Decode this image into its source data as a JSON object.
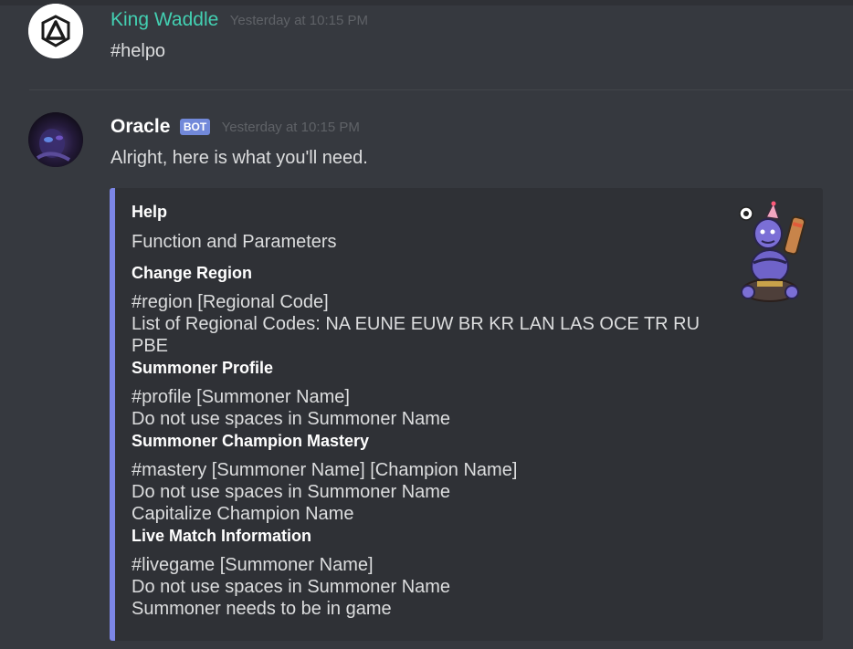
{
  "messages": [
    {
      "username": "King Waddle",
      "timestamp": "Yesterday at 10:15 PM",
      "content": "#helpo",
      "avatar_icon": "triangle-logo-icon",
      "name_color": "#43d0b2"
    },
    {
      "username": "Oracle",
      "bot_tag": "BOT",
      "timestamp": "Yesterday at 10:15 PM",
      "content": "Alright, here is what you'll need.",
      "avatar_icon": "dark-character-avatar",
      "name_color": "#ffffff",
      "embed": {
        "accent_color": "#7c86e6",
        "title": "Help",
        "description": "Function and Parameters",
        "thumbnail_icon": "blue-troll-character-icon",
        "fields": [
          {
            "name": "Change Region",
            "value": "#region [Regional Code]\n List of Regional Codes: NA EUNE EUW BR KR LAN LAS OCE TR RU\nPBE"
          },
          {
            "name": "Summoner Profile",
            "value": "#profile [Summoner Name]\n Do not use spaces in Summoner Name"
          },
          {
            "name": "Summoner Champion Mastery",
            "value": "#mastery [Summoner Name] [Champion Name]\n Do not use spaces in Summoner Name\n Capitalize Champion Name"
          },
          {
            "name": "Live Match Information",
            "value": "#livegame [Summoner Name]\n Do not use spaces in Summoner Name\n Summoner needs to be in game"
          }
        ]
      }
    }
  ],
  "colors": {
    "background": "#36393f",
    "embed_background": "#2f3136",
    "bot_tag": "#7289da",
    "timestamp": "#5f6267"
  }
}
